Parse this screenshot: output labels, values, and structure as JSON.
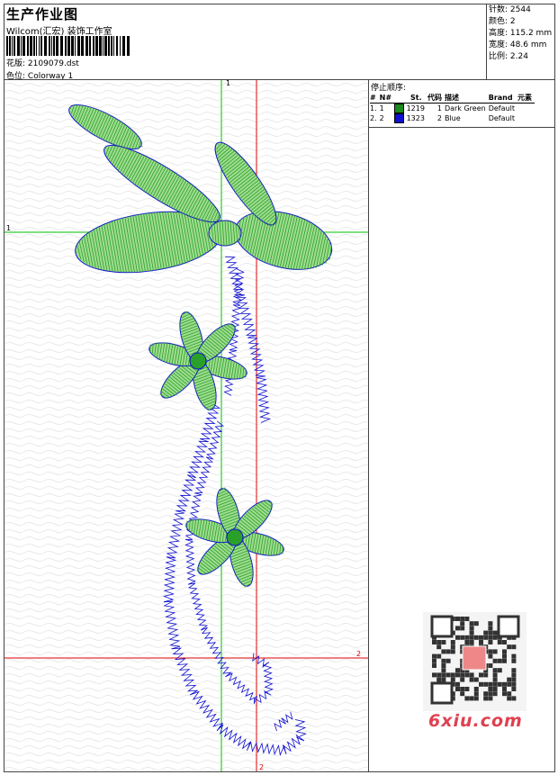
{
  "header": {
    "title": "生产作业图",
    "company": "Wilcom(汇宏) 装饰工作室",
    "design_label": "花版:",
    "design_value": "2109079.dst",
    "colorway_label": "色位:",
    "colorway_value": "Colorway 1"
  },
  "stats": {
    "stitches_label": "针数:",
    "stitches": "2544",
    "colors_label": "颜色:",
    "colors": "2",
    "height_label": "高度:",
    "height": "115.2 mm",
    "width_label": "宽度:",
    "width": "48.6 mm",
    "scale_label": "比例:",
    "scale": "2.24"
  },
  "stop_sequence": {
    "title": "停止顺序:",
    "columns": [
      "#",
      "N#",
      "St.",
      "代码",
      "描述",
      "Brand",
      "元素"
    ],
    "rows": [
      {
        "idx": "1.",
        "n": "1",
        "color": "#1a8a1a",
        "st": "1219",
        "code": "1",
        "desc": "Dark Green",
        "brand": "Default"
      },
      {
        "idx": "2.",
        "n": "2",
        "color": "#1010d0",
        "st": "1323",
        "code": "2",
        "desc": "Blue",
        "brand": "Default"
      }
    ]
  },
  "guides": {
    "green_label": "1",
    "red_label": "2"
  },
  "watermark": {
    "text": "6xiu.com"
  },
  "colors": {
    "green": "#2aa02a",
    "green_outline": "#1a8a1a",
    "blue": "#1010d0",
    "guide_green": "#00c000",
    "guide_red": "#e00000"
  }
}
